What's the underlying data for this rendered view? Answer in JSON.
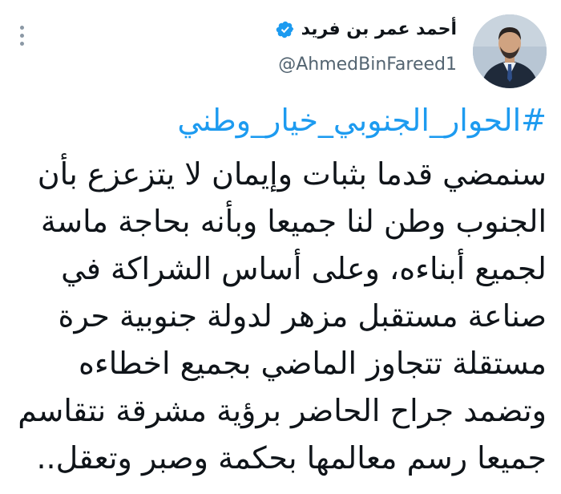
{
  "tweet": {
    "author_name": "أحمد عمر بن فريد",
    "handle": "@AhmedBinFareed1",
    "verified_icon": "verified-badge-icon",
    "more_icon": "more-vertical-icon",
    "hashtag": "#الحوار_الجنوبي_خيار_وطني",
    "lines": [
      "سنمضي قدما بثبات وإيمان لا يتزعزع بأن",
      "الجنوب وطن لنا جميعا وبأنه بحاجة ماسة",
      "لجميع أبناءه،  وعلى أساس الشراكة في",
      "صناعة مستقبل مزهر لدولة جنوبية حرة",
      "مستقلة تتجاوز الماضي بجميع اخطاءه",
      "وتضمد جراح الحاضر برؤية مشرقة نتقاسم",
      "جميعا رسم معالمها بحكمة وصبر وتعقل.."
    ]
  },
  "colors": {
    "link": "#1d9bf0",
    "text": "#0f1419",
    "secondary": "#536471",
    "verified": "#1d9bf0"
  }
}
